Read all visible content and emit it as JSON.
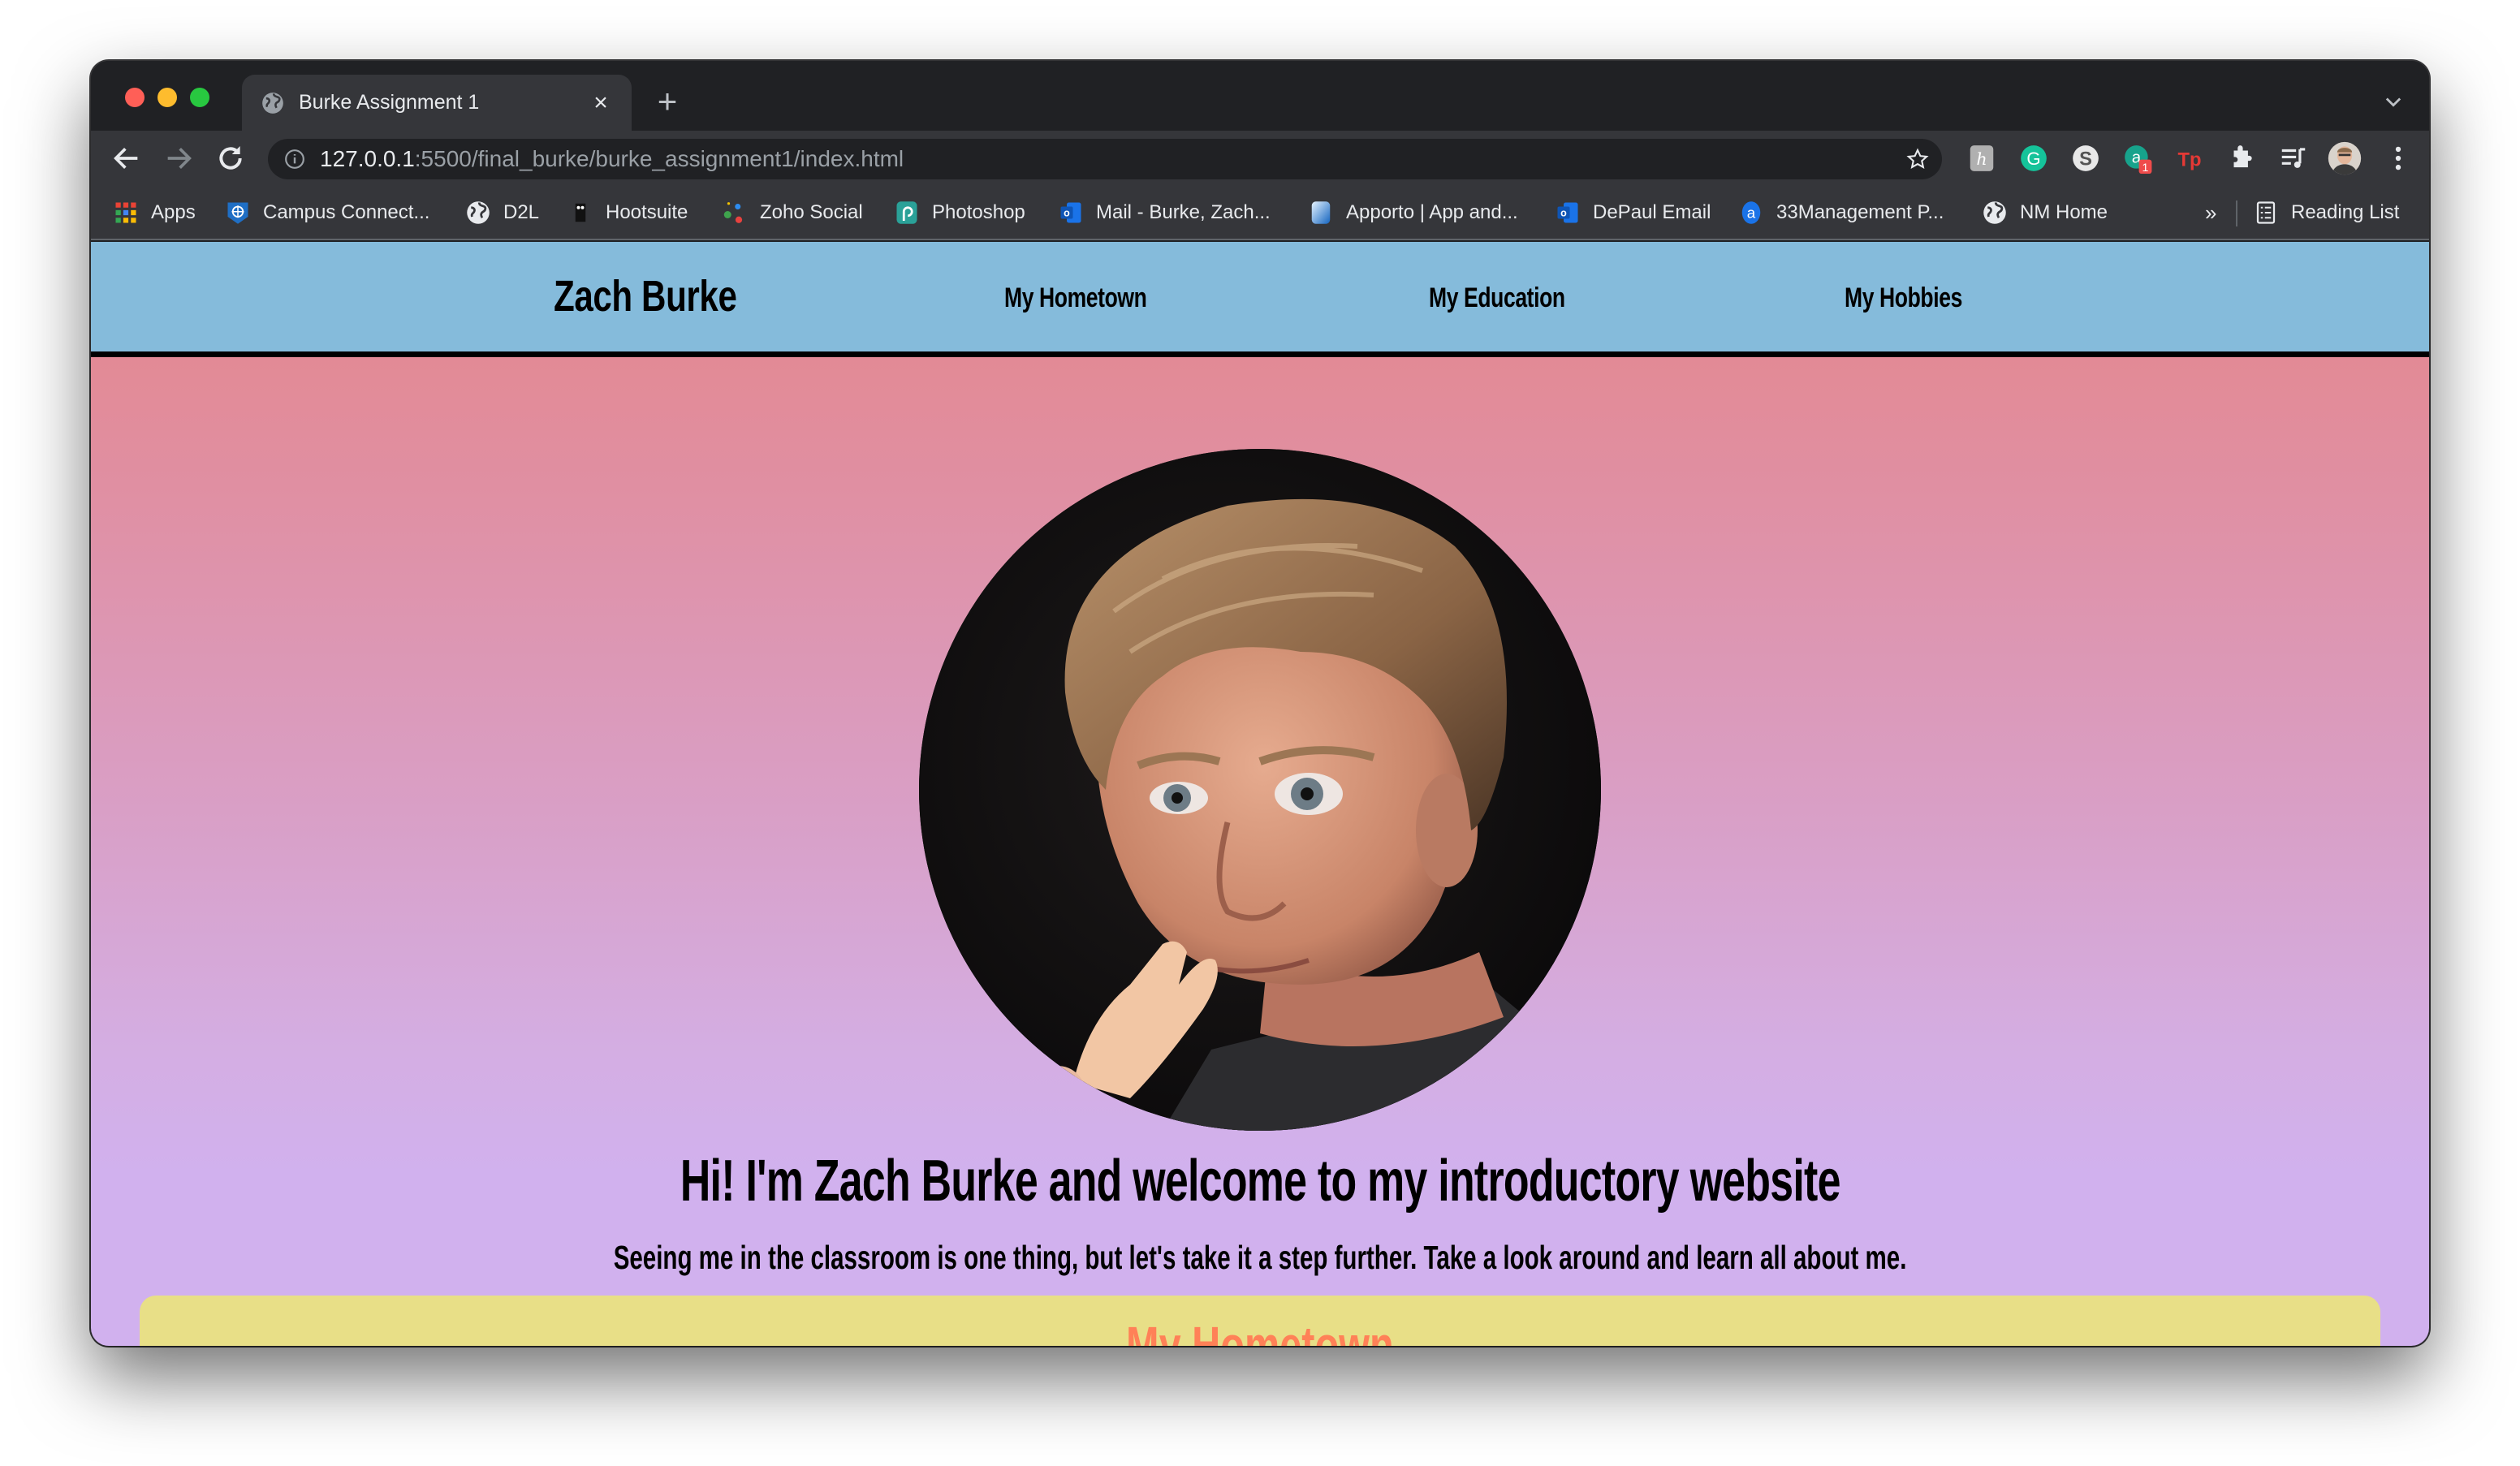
{
  "browser": {
    "tab": {
      "title": "Burke Assignment 1",
      "favicon": "globe-icon"
    },
    "new_tab_label": "+",
    "close_tab_label": "×",
    "address": {
      "host": "127.0.0.1",
      "path": ":5500/final_burke/burke_assignment1/index.html"
    },
    "extensions": [
      {
        "name": "honey-extension",
        "glyph": "h",
        "color": "#b0b0b0"
      },
      {
        "name": "grammarly-extension",
        "glyph": "G",
        "color": "#15c39a"
      },
      {
        "name": "s-extension",
        "glyph": "S",
        "color": "#e0e0e0"
      },
      {
        "name": "a-extension",
        "glyph": "a",
        "color": "#17a38c",
        "badge": "1"
      },
      {
        "name": "tp-extension",
        "glyph": "Tp",
        "color": "#e53935"
      }
    ],
    "bookmarks": [
      {
        "label": "Apps",
        "icon": "apps-grid-icon"
      },
      {
        "label": "Campus Connect...",
        "icon": "campus-connect-icon"
      },
      {
        "label": "D2L",
        "icon": "globe-icon"
      },
      {
        "label": "Hootsuite",
        "icon": "hootsuite-icon"
      },
      {
        "label": "Zoho Social",
        "icon": "zoho-icon"
      },
      {
        "label": "Photoshop",
        "icon": "photoshop-icon"
      },
      {
        "label": "Mail - Burke, Zach...",
        "icon": "outlook-icon"
      },
      {
        "label": "Apporto | App and...",
        "icon": "apporto-icon"
      },
      {
        "label": "DePaul Email",
        "icon": "outlook-icon"
      },
      {
        "label": "33Management P...",
        "icon": "a-circle-icon"
      },
      {
        "label": "NM Home",
        "icon": "globe-icon"
      }
    ],
    "overflow_label": "»",
    "reading_list_label": "Reading List"
  },
  "site": {
    "brand": "Zach Burke",
    "nav": [
      {
        "label": "My Hometown"
      },
      {
        "label": "My Education"
      },
      {
        "label": "My Hobbies"
      }
    ],
    "portrait_alt": "Portrait of Zach Burke",
    "headline": "Hi! I'm Zach Burke and welcome to my introductory website",
    "subheadline": "Seeing me in the classroom is one thing, but let's take it a step further. Take a look around and learn all about me.",
    "section_title": "My Hometown",
    "colors": {
      "nav_bg": "#85BBDB",
      "gradient_top": "#E5868A",
      "gradient_bottom": "#D1B1EE",
      "card_bg": "#E8DF87",
      "section_title": "#FF8157"
    }
  }
}
